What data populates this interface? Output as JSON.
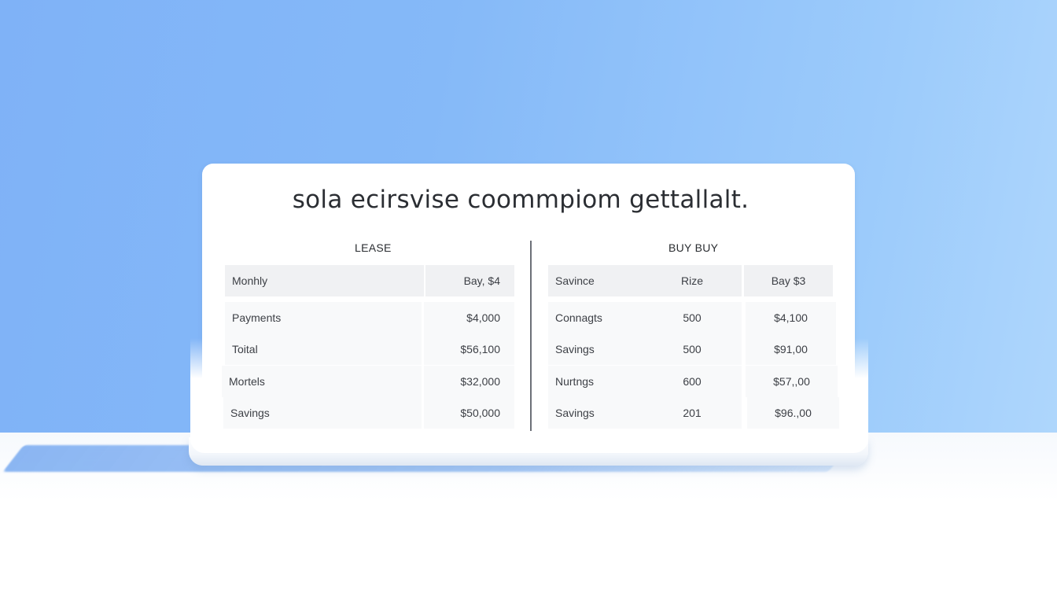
{
  "title": "sola ecirsvise coommpiom gettallalt.",
  "lease": {
    "heading": "LEASE",
    "header": [
      "Monhly",
      "Bay, $4"
    ],
    "rows": [
      [
        "Payments",
        "$4,000"
      ],
      [
        "Toital",
        "$56,100"
      ],
      [
        "Mortels",
        "$32,000"
      ],
      [
        "Savings",
        "$50,000"
      ]
    ]
  },
  "buy": {
    "heading": "BUY BUY",
    "header": [
      "Savince",
      "Rize",
      "Bay $3"
    ],
    "rows": [
      [
        "Connagts",
        "500",
        "$4,100"
      ],
      [
        "Savings",
        "500",
        "$91,00"
      ],
      [
        "Nurtngs",
        "600",
        "$57,,00"
      ],
      [
        "Savings",
        "201",
        "$96.,00"
      ]
    ]
  },
  "colors": {
    "sky_left": "#7fb2f7",
    "sky_right": "#aed6fc",
    "panel": "#ffffff",
    "header_cell": "#f0f1f3",
    "body_cell": "#f8f9fa",
    "text": "#2b2e33"
  }
}
